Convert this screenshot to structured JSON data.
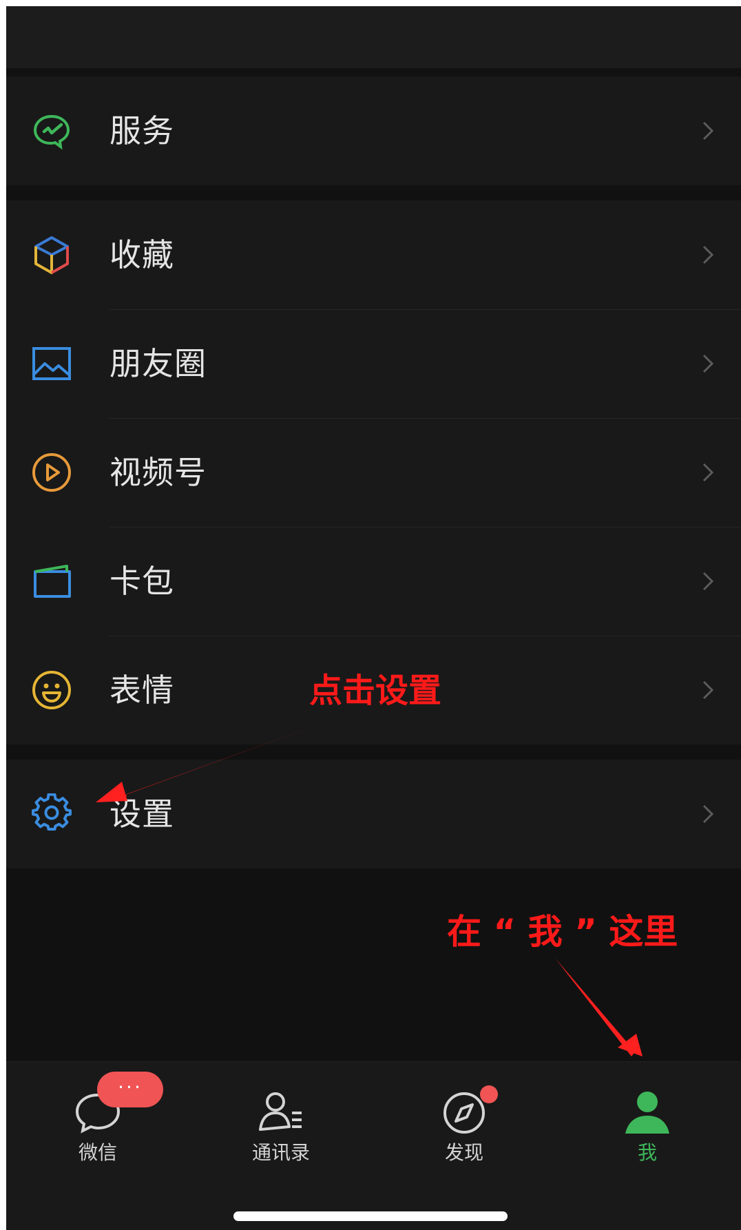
{
  "menu": {
    "service": "服务",
    "favorites": "收藏",
    "moments": "朋友圈",
    "channels": "视频号",
    "cards": "卡包",
    "stickers": "表情",
    "settings": "设置"
  },
  "icons": {
    "service": "wechat-pay-check-icon",
    "favorites": "cube-icon",
    "moments": "picture-icon",
    "channels": "play-circle-icon",
    "cards": "wallet-card-icon",
    "stickers": "smiley-icon",
    "settings": "gear-icon",
    "chevron": "chevron-right-icon"
  },
  "annotations": {
    "tap_settings": "点击设置",
    "here_me": "在 “ 我 ” 这里"
  },
  "tabbar": {
    "chats": "微信",
    "contacts": "通讯录",
    "discover": "发现",
    "me": "我",
    "chats_badge": "···",
    "active_tab": "me"
  },
  "colors": {
    "background": "#111111",
    "row_bg": "#191919",
    "text": "#e5e5e5",
    "active_green": "#3eb75a",
    "badge_red": "#f05454",
    "annotation_red": "#ff1a1a"
  }
}
